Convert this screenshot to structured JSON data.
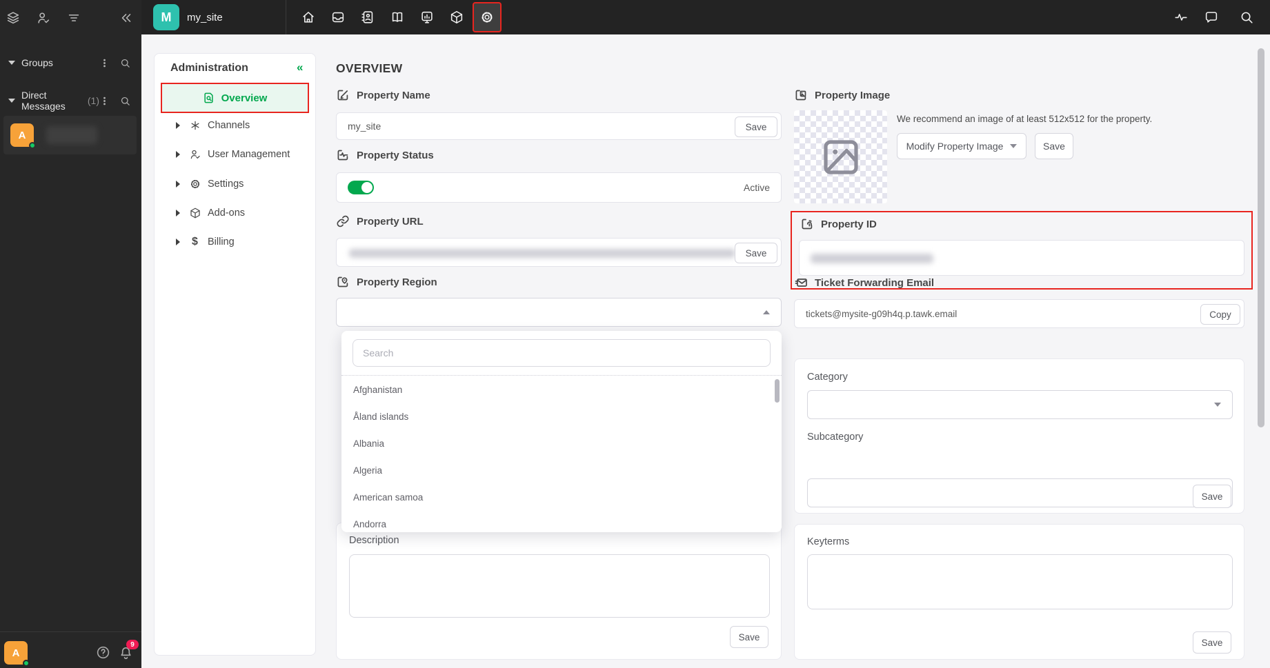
{
  "colors": {
    "accent_green": "#03a84e",
    "highlight_red": "#e8251f",
    "avatar_teal": "#2ec1ae",
    "avatar_orange": "#f7a239",
    "topbar_bg": "#232323",
    "rail_bg": "#272727"
  },
  "rail": {
    "groups": {
      "label": "Groups"
    },
    "direct_messages": {
      "label": "Direct Messages",
      "count": "(1)"
    },
    "dm_avatar_initial": "A",
    "user_avatar_initial": "A",
    "notification_badge": "9"
  },
  "topbar": {
    "property_initial": "M",
    "property_name": "my_site"
  },
  "admin_panel": {
    "title": "Administration",
    "collapse_glyph": "«",
    "items": [
      {
        "label": "Overview",
        "active": true
      },
      {
        "label": "Channels"
      },
      {
        "label": "User Management"
      },
      {
        "label": "Settings"
      },
      {
        "label": "Add-ons"
      },
      {
        "label": "Billing"
      }
    ]
  },
  "overview": {
    "title": "OVERVIEW",
    "property_name": {
      "label": "Property Name",
      "value": "my_site",
      "save_label": "Save"
    },
    "property_status": {
      "label": "Property Status",
      "value": "Active"
    },
    "property_url": {
      "label": "Property URL",
      "save_label": "Save"
    },
    "property_region": {
      "label": "Property Region",
      "search_placeholder": "Search",
      "options": [
        "Afghanistan",
        "Åland islands",
        "Albania",
        "Algeria",
        "American samoa",
        "Andorra"
      ]
    },
    "description": {
      "label": "Description",
      "save_label": "Save"
    },
    "property_image": {
      "label": "Property Image",
      "hint": "We recommend an image of at least 512x512 for the property.",
      "modify_label": "Modify Property Image",
      "save_label": "Save"
    },
    "property_id": {
      "label": "Property ID"
    },
    "ticket_forwarding_email": {
      "label": "Ticket Forwarding Email",
      "value": "tickets@mysite-g09h4q.p.tawk.email",
      "copy_label": "Copy"
    },
    "category": {
      "label": "Category",
      "save_label": "Save"
    },
    "subcategory": {
      "label": "Subcategory"
    },
    "keyterms": {
      "label": "Keyterms",
      "save_label": "Save"
    }
  }
}
